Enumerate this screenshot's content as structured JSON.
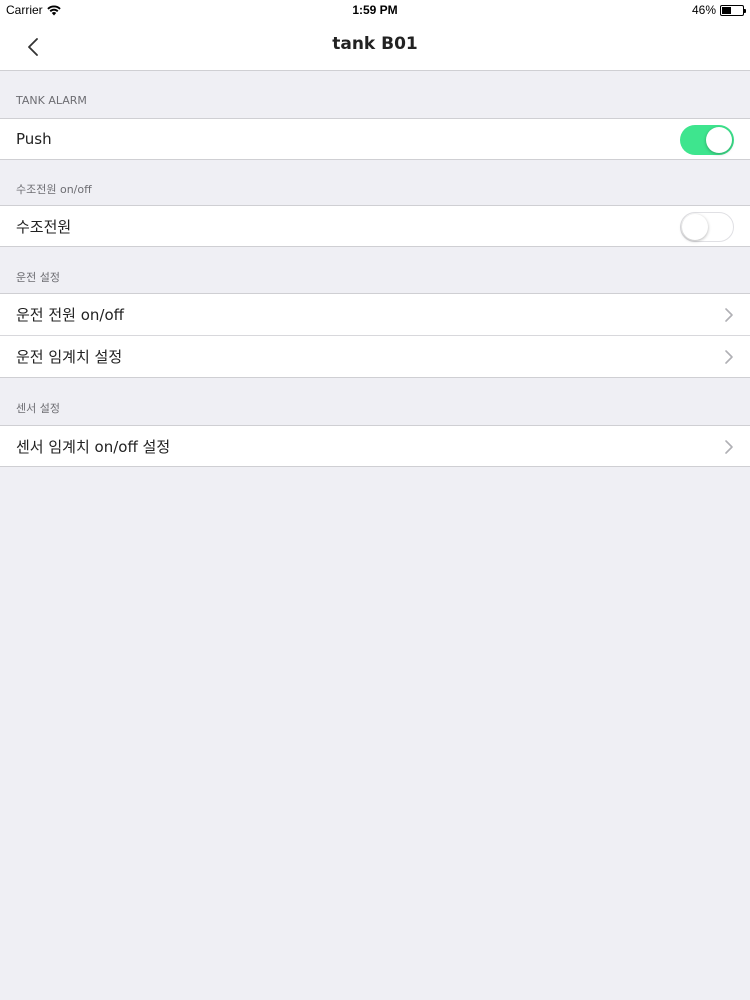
{
  "status_bar": {
    "carrier": "Carrier",
    "time": "1:59 PM",
    "battery_label": "46%",
    "battery_level": 0.46
  },
  "nav": {
    "title": "tank B01",
    "back_icon": "chevron-left-icon"
  },
  "sections": {
    "tank_alarm": {
      "header": "TANK ALARM",
      "push_label": "Push",
      "push_on": true
    },
    "tank_power": {
      "header": "수조전원 on/off",
      "power_label": "수조전원",
      "power_on": false
    },
    "operation": {
      "header": "운전 설정",
      "items": [
        {
          "label": "운전 전원 on/off"
        },
        {
          "label": "운전 임계치 설정"
        }
      ]
    },
    "sensor": {
      "header": "센서 설정",
      "items": [
        {
          "label": "센서 임계치 on/off 설정"
        }
      ]
    }
  },
  "colors": {
    "toggle_on": "#3ee58e",
    "background": "#efeff4"
  }
}
